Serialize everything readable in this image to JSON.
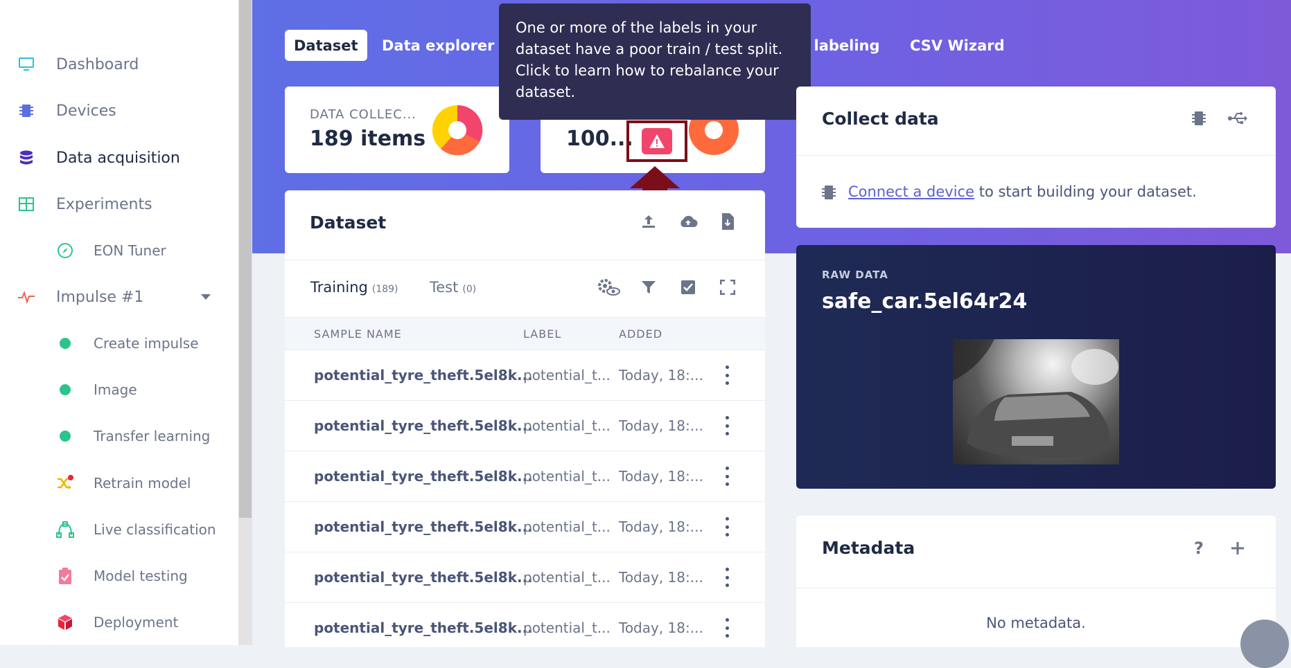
{
  "sidebar": {
    "items": [
      {
        "label": "Dashboard"
      },
      {
        "label": "Devices"
      },
      {
        "label": "Data acquisition"
      },
      {
        "label": "Experiments"
      },
      {
        "label": "EON Tuner"
      },
      {
        "label": "Impulse #1"
      },
      {
        "label": "Create impulse"
      },
      {
        "label": "Image"
      },
      {
        "label": "Transfer learning"
      },
      {
        "label": "Retrain model"
      },
      {
        "label": "Live classification"
      },
      {
        "label": "Model testing"
      },
      {
        "label": "Deployment"
      }
    ]
  },
  "tabs": [
    {
      "label": "Dataset"
    },
    {
      "label": "Data explorer"
    },
    {
      "label": "l labeling"
    },
    {
      "label": "CSV Wizard"
    }
  ],
  "stats": {
    "collected_label": "DATA COLLEC...",
    "collected_value": "189 items",
    "split_value": "100..."
  },
  "tooltip": {
    "text": "One or more of the labels in your dataset have a poor train / test split. Click to learn how to rebalance your dataset."
  },
  "dataset": {
    "title": "Dataset",
    "training_label": "Training",
    "training_count": "(189)",
    "test_label": "Test",
    "test_count": "(0)",
    "columns": [
      "SAMPLE NAME",
      "LABEL",
      "ADDED"
    ],
    "rows": [
      {
        "name": "potential_tyre_theft.5el8k...",
        "label": "potential_t...",
        "added": "Today, 18:..."
      },
      {
        "name": "potential_tyre_theft.5el8k...",
        "label": "potential_t...",
        "added": "Today, 18:..."
      },
      {
        "name": "potential_tyre_theft.5el8k...",
        "label": "potential_t...",
        "added": "Today, 18:..."
      },
      {
        "name": "potential_tyre_theft.5el8k...",
        "label": "potential_t...",
        "added": "Today, 18:..."
      },
      {
        "name": "potential_tyre_theft.5el8k...",
        "label": "potential_t...",
        "added": "Today, 18:..."
      },
      {
        "name": "potential_tyre_theft.5el8k...",
        "label": "potential_t...",
        "added": "Today, 18:..."
      }
    ]
  },
  "collect": {
    "title": "Collect data",
    "link": "Connect a device",
    "text": " to start building your dataset."
  },
  "raw": {
    "label": "RAW DATA",
    "title": "safe_car.5el64r24"
  },
  "metadata": {
    "title": "Metadata",
    "empty": "No metadata."
  },
  "colors": {
    "accent": "#6366e6",
    "warning": "#f2456b",
    "highlight_border": "#7a0f1a"
  }
}
